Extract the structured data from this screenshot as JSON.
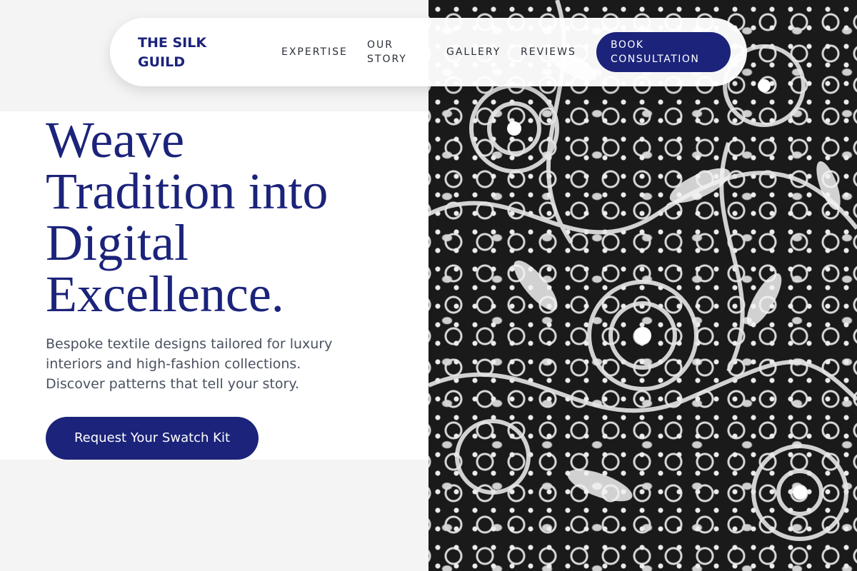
{
  "brand": {
    "name": "THE SILK GUILD"
  },
  "nav": {
    "items": [
      {
        "label": "EXPERTISE"
      },
      {
        "label": "OUR STORY"
      },
      {
        "label": "GALLERY"
      },
      {
        "label": "REVIEWS"
      }
    ],
    "cta_label": "BOOK CONSULTATION"
  },
  "hero": {
    "title": "Weave Tradition into Digital Excellence.",
    "subtitle": "Bespoke textile designs tailored for luxury interiors and high-fashion collections. Discover patterns that tell your story.",
    "cta_label": "Request Your Swatch Kit"
  },
  "colors": {
    "accent": "#1b237a",
    "page_background": "#f4f4f4",
    "panel_background": "#ffffff",
    "body_text": "#4a5160"
  },
  "image": {
    "subject": "white-lace-pattern"
  }
}
